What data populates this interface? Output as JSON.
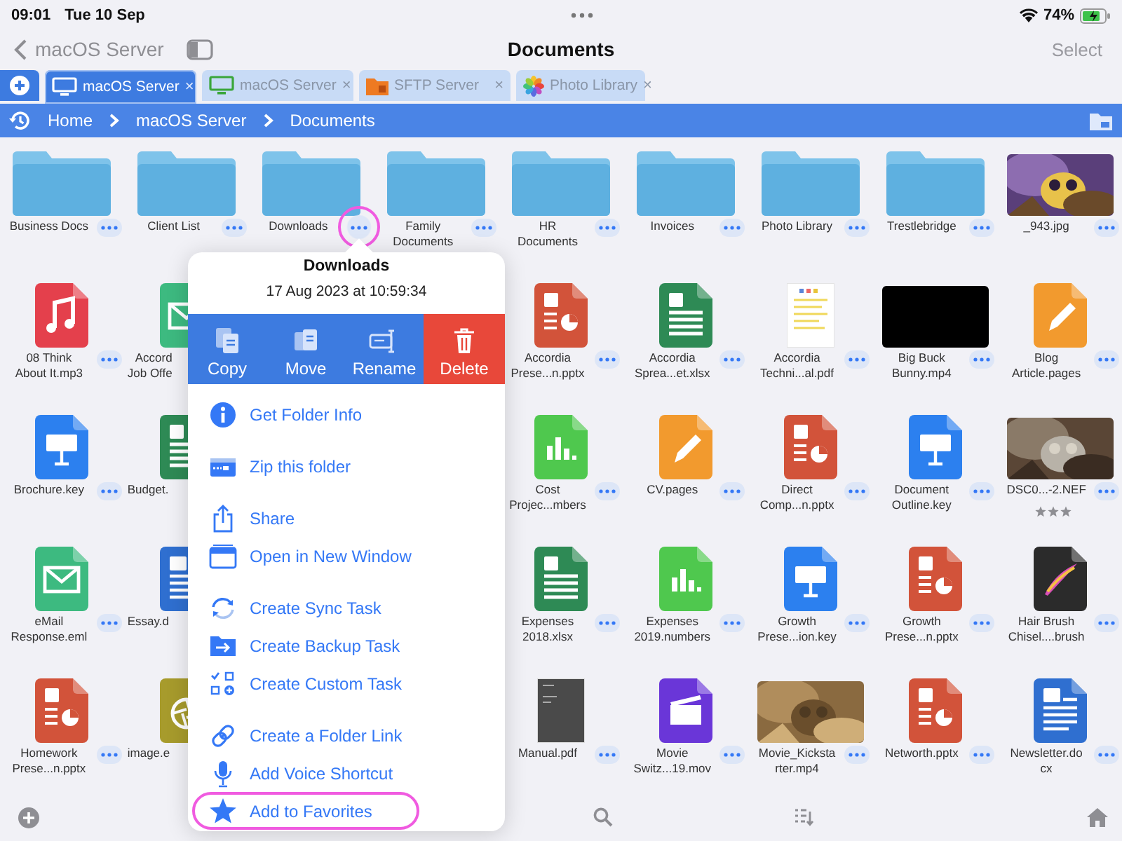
{
  "status_bar": {
    "time": "09:01",
    "date": "Tue 10 Sep",
    "battery": "74%"
  },
  "nav": {
    "back": "macOS Server",
    "title": "Documents",
    "action": "Select"
  },
  "tabs": [
    {
      "kind": "server",
      "label": "macOS Server",
      "close": "×",
      "selected": true
    },
    {
      "kind": "server",
      "label": "macOS Server",
      "close": "×",
      "selected": false
    },
    {
      "kind": "sftp",
      "label": "SFTP Server",
      "close": "×",
      "selected": false
    },
    {
      "kind": "photos",
      "label": "Photo Library",
      "close": "×",
      "selected": false
    }
  ],
  "breadcrumbs": [
    "Home",
    "macOS Server",
    "Documents"
  ],
  "rows": [
    {
      "items": [
        {
          "kind": "folder",
          "lines": [
            "Business Docs"
          ],
          "partial": false,
          "highlighted": false
        },
        {
          "kind": "folder",
          "lines": [
            "Client List"
          ],
          "partial": false,
          "highlighted": false
        },
        {
          "kind": "folder",
          "lines": [
            "Downloads"
          ],
          "partial": false,
          "highlighted": true
        },
        {
          "kind": "folder",
          "lines": [
            "Family",
            "Documents"
          ],
          "partial": false,
          "highlighted": false
        },
        {
          "kind": "folder",
          "lines": [
            "HR",
            "Documents"
          ],
          "partial": false,
          "highlighted": false
        },
        {
          "kind": "folder",
          "lines": [
            "Invoices"
          ],
          "partial": false,
          "highlighted": false
        },
        {
          "kind": "folder",
          "lines": [
            "Photo Library"
          ],
          "partial": false,
          "highlighted": false
        },
        {
          "kind": "folder",
          "lines": [
            "Trestlebridge"
          ],
          "partial": false,
          "highlighted": false
        },
        {
          "lines": [
            "_943.jpg"
          ],
          "partial": false,
          "highlighted": false
        }
      ]
    },
    {
      "items": [
        {
          "kind": "mp3",
          "lines": [
            "08 Think",
            "About It.mp3"
          ],
          "partial": false,
          "highlighted": false
        },
        {
          "kind": "email",
          "lines": [
            "Accord",
            "Job Offe"
          ],
          "partial": true
        },
        {
          "kind": "covered"
        },
        {
          "kind": "covered"
        },
        {
          "kind": "pptx",
          "lines": [
            "Accordia",
            "Prese...n.pptx"
          ],
          "partial": false,
          "highlighted": false
        },
        {
          "kind": "xlsx",
          "lines": [
            "Accordia",
            "Sprea...et.xlsx"
          ],
          "partial": false,
          "highlighted": false
        },
        {
          "kind": "pdf",
          "lines": [
            "Accordia",
            "Techni...al.pdf"
          ],
          "partial": false,
          "highlighted": false
        },
        {
          "kind": "video",
          "lines": [
            "Big Buck",
            "Bunny.mp4"
          ],
          "partial": false,
          "highlighted": false
        },
        {
          "kind": "pages",
          "lines": [
            "Blog",
            "Article.pages"
          ],
          "partial": false,
          "highlighted": false
        }
      ]
    },
    {
      "items": [
        {
          "kind": "key",
          "lines": [
            "Brochure.key"
          ],
          "partial": false,
          "highlighted": false
        },
        {
          "kind": "xlsx",
          "lines": [
            "Budget."
          ],
          "partial": true
        },
        {
          "kind": "covered"
        },
        {
          "kind": "covered"
        },
        {
          "kind": "numbers",
          "lines": [
            "Cost",
            "Projec...mbers"
          ],
          "partial": false,
          "highlighted": false
        },
        {
          "kind": "pages",
          "lines": [
            "CV.pages"
          ],
          "partial": false,
          "highlighted": false
        },
        {
          "kind": "pptx",
          "lines": [
            "Direct",
            "Comp...n.pptx"
          ],
          "partial": false,
          "highlighted": false
        },
        {
          "kind": "key",
          "lines": [
            "Document",
            "Outline.key"
          ],
          "partial": false,
          "highlighted": false
        },
        {
          "lines": [
            "DSC0...-2.NEF"
          ],
          "partial": false,
          "highlighted": false,
          "stars": 3
        }
      ]
    },
    {
      "items": [
        {
          "kind": "email",
          "lines": [
            "eMail",
            "Response.eml"
          ],
          "partial": false,
          "highlighted": false
        },
        {
          "kind": "docx",
          "lines": [
            "Essay.d"
          ],
          "partial": true
        },
        {
          "kind": "covered"
        },
        {
          "kind": "covered"
        },
        {
          "kind": "xlsx",
          "lines": [
            "Expenses",
            "2018.xlsx"
          ],
          "partial": false,
          "highlighted": false
        },
        {
          "kind": "numbers",
          "lines": [
            "Expenses",
            "2019.numbers"
          ],
          "partial": false,
          "highlighted": false
        },
        {
          "kind": "key",
          "lines": [
            "Growth",
            "Prese...ion.key"
          ],
          "partial": false,
          "highlighted": false
        },
        {
          "kind": "pptx",
          "lines": [
            "Growth",
            "Prese...n.pptx"
          ],
          "partial": false,
          "highlighted": false
        },
        {
          "kind": "brush",
          "lines": [
            "Hair Brush",
            "Chisel....brush"
          ],
          "partial": false,
          "highlighted": false
        }
      ]
    },
    {
      "items": [
        {
          "kind": "pptx",
          "lines": [
            "Homework",
            "Prese...n.pptx"
          ],
          "partial": false,
          "highlighted": false
        },
        {
          "lines": [
            "image.e"
          ],
          "partial": true
        },
        {
          "kind": "covered"
        },
        {
          "kind": "covered"
        },
        {
          "kind": "manual",
          "lines": [
            "Manual.pdf"
          ],
          "partial": false,
          "highlighted": false
        },
        {
          "kind": "mov",
          "lines": [
            "Movie",
            "Switz...19.mov"
          ],
          "partial": false,
          "highlighted": false
        },
        {
          "lines": [
            "Movie_Kicksta",
            "rter.mp4"
          ],
          "partial": false,
          "highlighted": false
        },
        {
          "kind": "pptx",
          "lines": [
            "Networth.pptx"
          ],
          "partial": false,
          "highlighted": false
        },
        {
          "kind": "docx",
          "lines": [
            "Newsletter.do",
            "cx"
          ],
          "partial": false,
          "highlighted": false
        }
      ]
    }
  ],
  "popover": {
    "title": "Downloads",
    "date": "17 Aug 2023 at 10:59:34",
    "actions": [
      {
        "kind": "copy",
        "label": "Copy",
        "destructive": false
      },
      {
        "kind": "move",
        "label": "Move",
        "destructive": false
      },
      {
        "kind": "rename",
        "label": "Rename",
        "destructive": false
      },
      {
        "kind": "delete",
        "label": "Delete",
        "destructive": true
      }
    ],
    "groups": [
      {
        "items": [
          {
            "kind": "info",
            "label": "Get Folder Info",
            "highlighted": false
          }
        ]
      },
      {
        "items": [
          {
            "kind": "zip",
            "label": "Zip this folder",
            "highlighted": false
          }
        ]
      },
      {
        "items": [
          {
            "kind": "share",
            "label": "Share",
            "highlighted": false
          },
          {
            "kind": "window",
            "label": "Open in New Window",
            "highlighted": false
          }
        ]
      },
      {
        "items": [
          {
            "kind": "sync",
            "label": "Create Sync Task",
            "highlighted": false
          },
          {
            "kind": "backup",
            "label": "Create Backup Task",
            "highlighted": false
          },
          {
            "kind": "custom",
            "label": "Create Custom Task",
            "highlighted": false
          }
        ]
      },
      {
        "items": [
          {
            "kind": "link",
            "label": "Create a Folder Link",
            "highlighted": false
          },
          {
            "kind": "mic",
            "label": "Add Voice Shortcut",
            "highlighted": false
          },
          {
            "kind": "star",
            "label": "Add to Favorites",
            "highlighted": true
          }
        ]
      }
    ]
  }
}
